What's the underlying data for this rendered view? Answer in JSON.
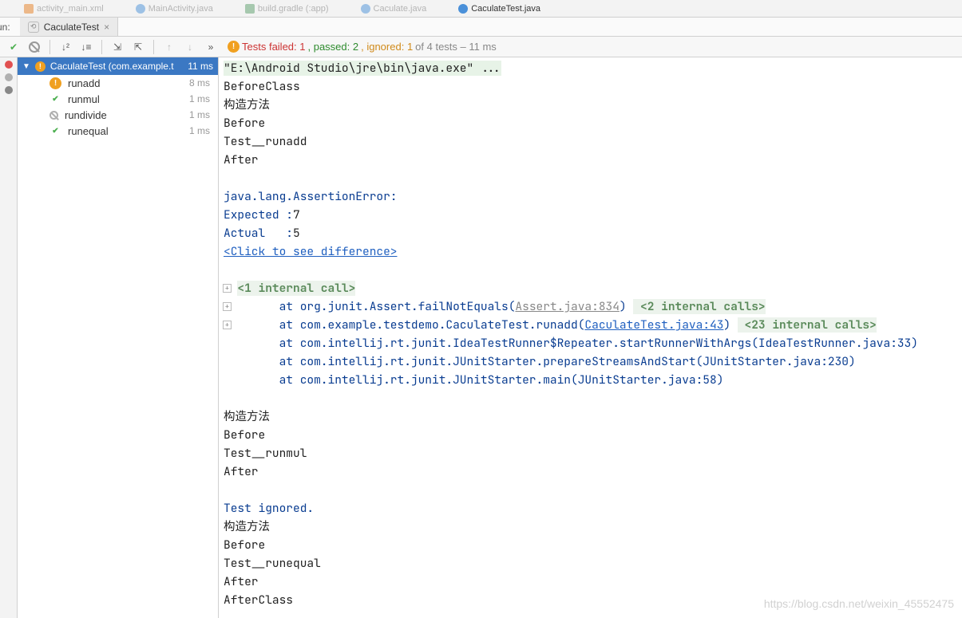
{
  "editor_tabs": [
    {
      "label": "activity_main.xml",
      "kind": "xml"
    },
    {
      "label": "MainActivity.java",
      "kind": "java"
    },
    {
      "label": "build.gradle (:app)",
      "kind": "gradle"
    },
    {
      "label": "Caculate.java",
      "kind": "java"
    },
    {
      "label": "CaculateTest.java",
      "kind": "java",
      "active": true
    }
  ],
  "run_label": "un:",
  "run_tab_label": "CaculateTest",
  "status": {
    "prefix": "Tests failed: ",
    "failed": "1",
    "passed_lbl": ", passed: ",
    "passed": "2",
    "ignored_lbl": ", ignored: ",
    "ignored": "1",
    "suffix": " of 4 tests – 11 ms"
  },
  "tree": {
    "header_label": "CaculateTest (com.example.test",
    "header_time": "11 ms",
    "items": [
      {
        "name": "runadd",
        "time": "8 ms",
        "status": "fail"
      },
      {
        "name": "runmul",
        "time": "1 ms",
        "status": "pass"
      },
      {
        "name": "rundivide",
        "time": "1 ms",
        "status": "ignore"
      },
      {
        "name": "runequal",
        "time": "1 ms",
        "status": "pass"
      }
    ]
  },
  "console": {
    "cmd": "\"E:\\Android Studio\\jre\\bin\\java.exe\" ...",
    "lines1": [
      "BeforeClass",
      "构造方法",
      "Before",
      "Test__runadd",
      "After",
      ""
    ],
    "err_head": "java.lang.AssertionError: ",
    "expected_lbl": "Expected :",
    "expected_val": "7",
    "actual_lbl": "Actual   :",
    "actual_val": "5",
    "click_diff": "<Click to see difference>",
    "fold1": "<1 internal call>",
    "trace1_pre": "\tat org.junit.Assert.failNotEquals(",
    "trace1_link": "Assert.java:834",
    "trace1_post": ")",
    "fold2": " <2 internal calls>",
    "trace2_pre": "\tat com.example.testdemo.CaculateTest.runadd(",
    "trace2_link": "CaculateTest.java:43",
    "trace2_post": ")",
    "fold3": " <23 internal calls>",
    "trace3": "\tat com.intellij.rt.junit.IdeaTestRunner$Repeater.startRunnerWithArgs(IdeaTestRunner.java:33)",
    "trace4": "\tat com.intellij.rt.junit.JUnitStarter.prepareStreamsAndStart(JUnitStarter.java:230)",
    "trace5": "\tat com.intellij.rt.junit.JUnitStarter.main(JUnitStarter.java:58)",
    "lines2": [
      "",
      "构造方法",
      "Before",
      "Test__runmul",
      "After",
      ""
    ],
    "ignored": "Test ignored.",
    "lines3": [
      "构造方法",
      "Before",
      "Test__runequal",
      "After",
      "AfterClass"
    ]
  },
  "watermark": "https://blog.csdn.net/weixin_45552475"
}
